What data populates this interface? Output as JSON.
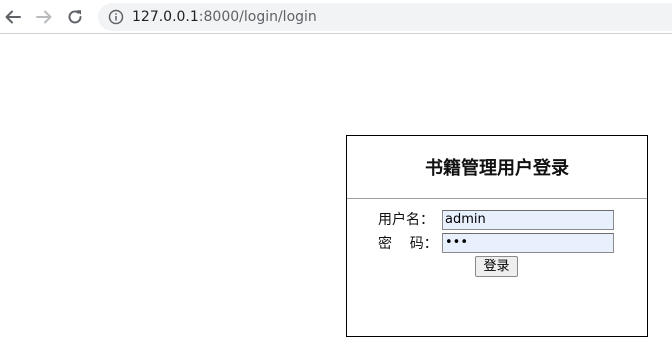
{
  "browser": {
    "url_host": "127.0.0.1",
    "url_rest": ":8000/login/login"
  },
  "login": {
    "title": "书籍管理用户登录",
    "username_label": "用户名：",
    "username_value": "admin",
    "password_label": "密    码：",
    "password_value": "•••",
    "submit_label": "登录"
  }
}
